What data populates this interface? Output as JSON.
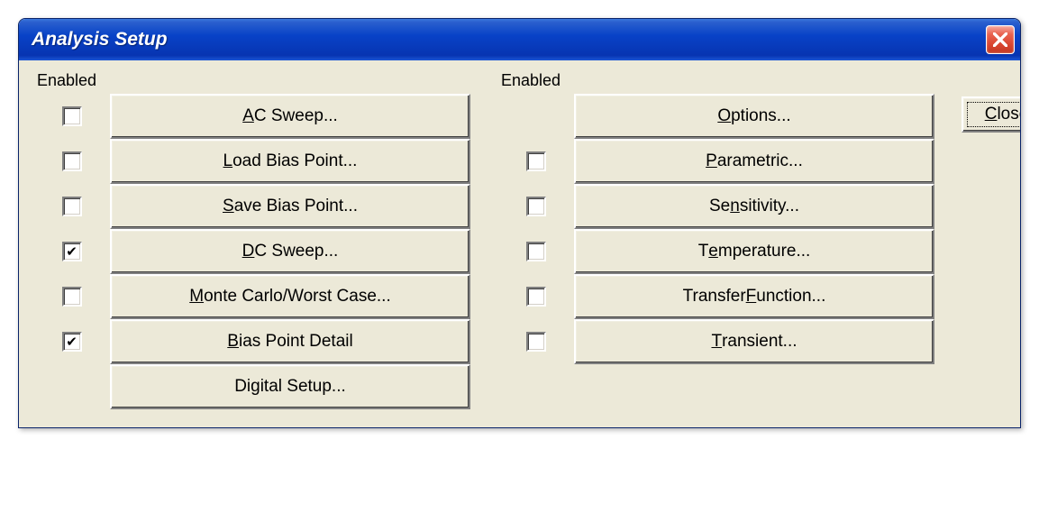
{
  "window": {
    "title": "Analysis Setup"
  },
  "headers": {
    "enabled_left": "Enabled",
    "enabled_right": "Enabled"
  },
  "left_column": [
    {
      "checkbox_visible": true,
      "checked": false,
      "label_pre": "",
      "mnemonic": "A",
      "label_post": "C Sweep..."
    },
    {
      "checkbox_visible": true,
      "checked": false,
      "label_pre": "",
      "mnemonic": "L",
      "label_post": "oad Bias Point..."
    },
    {
      "checkbox_visible": true,
      "checked": false,
      "label_pre": "",
      "mnemonic": "S",
      "label_post": "ave Bias Point..."
    },
    {
      "checkbox_visible": true,
      "checked": true,
      "label_pre": "",
      "mnemonic": "D",
      "label_post": "C Sweep..."
    },
    {
      "checkbox_visible": true,
      "checked": false,
      "label_pre": "",
      "mnemonic": "M",
      "label_post": "onte Carlo/Worst Case..."
    },
    {
      "checkbox_visible": true,
      "checked": true,
      "label_pre": "",
      "mnemonic": "B",
      "label_post": "ias Point Detail"
    },
    {
      "checkbox_visible": false,
      "checked": false,
      "label_pre": "Digital Setup...",
      "mnemonic": "",
      "label_post": ""
    }
  ],
  "right_column": [
    {
      "checkbox_visible": false,
      "checked": false,
      "label_pre": "",
      "mnemonic": "O",
      "label_post": "ptions..."
    },
    {
      "checkbox_visible": true,
      "checked": false,
      "label_pre": "",
      "mnemonic": "P",
      "label_post": "arametric..."
    },
    {
      "checkbox_visible": true,
      "checked": false,
      "label_pre": "Se",
      "mnemonic": "n",
      "label_post": "sitivity..."
    },
    {
      "checkbox_visible": true,
      "checked": false,
      "label_pre": "T",
      "mnemonic": "e",
      "label_post": "mperature..."
    },
    {
      "checkbox_visible": true,
      "checked": false,
      "label_pre": "Transfer ",
      "mnemonic": "F",
      "label_post": "unction..."
    },
    {
      "checkbox_visible": true,
      "checked": false,
      "label_pre": "",
      "mnemonic": "T",
      "label_post": "ransient..."
    }
  ],
  "close_button": {
    "label_pre": "",
    "mnemonic": "C",
    "label_post": "lose"
  }
}
